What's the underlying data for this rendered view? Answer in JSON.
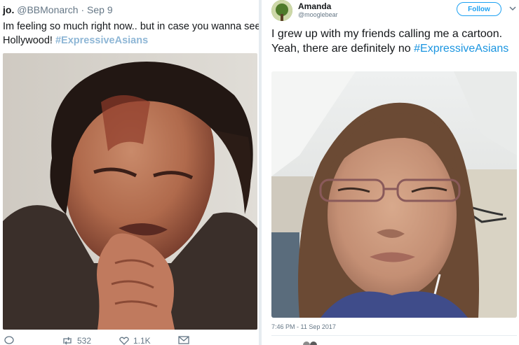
{
  "left_tweet": {
    "display_name": "jo.",
    "handle": "@BBMonarch",
    "separator": "·",
    "date": "Sep 9",
    "text_line1": "Im feeling so much right now.. but in case you wanna see",
    "text_line2_prefix": "Hollywood! ",
    "hashtag": "#ExpressiveAsians",
    "actions": {
      "reply_icon": "reply-icon",
      "retweet_icon": "retweet-icon",
      "retweet_count": "532",
      "like_icon": "heart-icon",
      "like_count": "1.1K",
      "dm_icon": "envelope-icon"
    }
  },
  "right_tweet": {
    "display_name": "Amanda",
    "handle": "@mooglebear",
    "follow_label": "Follow",
    "text": "I grew up with my friends calling me a cartoon. Yeah, there are definitely no",
    "hashtag": "#ExpressiveAsians",
    "timestamp": "7:46 PM - 11 Sep 2017"
  },
  "colors": {
    "link": "#1b95e0",
    "follow": "#1da1f2",
    "secondary_text": "#657786"
  }
}
